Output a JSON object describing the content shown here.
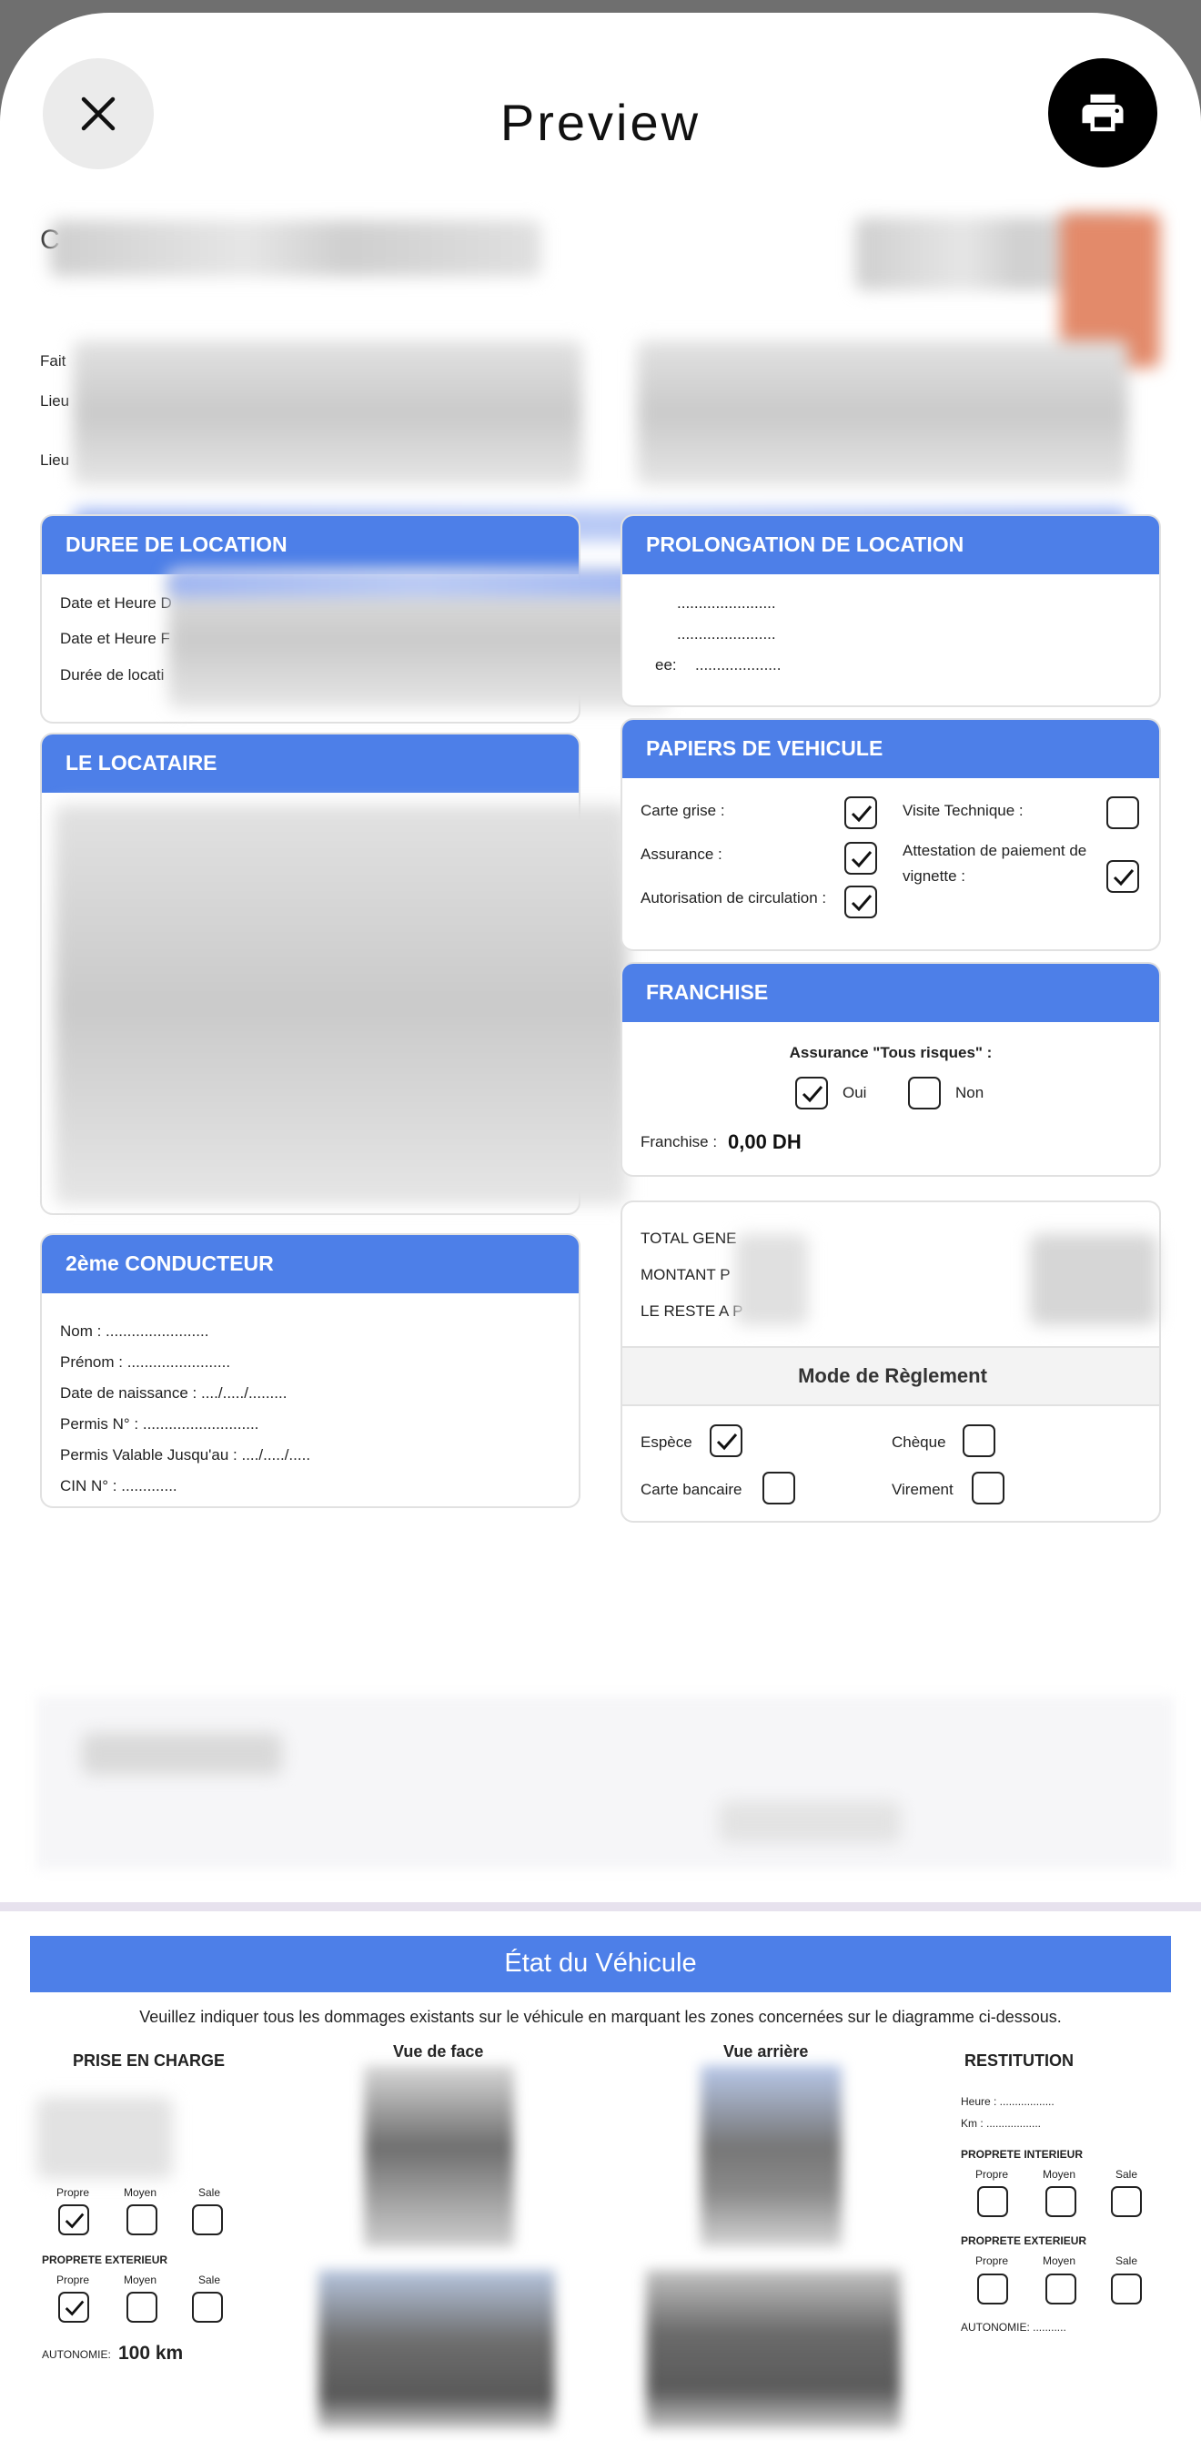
{
  "header": {
    "title": "Preview",
    "close_icon": "close-icon",
    "print_icon": "printer-icon"
  },
  "top": {
    "c_letter": "C",
    "fait": "Fait",
    "lieu1": "Lieu",
    "lieu2": "Lieu"
  },
  "duree": {
    "title": "DUREE DE LOCATION",
    "row1": "Date et Heure D",
    "row2": "Date et Heure F",
    "row3": "Durée de locati"
  },
  "prolongation": {
    "title": "PROLONGATION DE LOCATION",
    "row1": ".......................",
    "row2": ".......................",
    "row3_prefix": "ee:",
    "row3": "...................."
  },
  "locataire": {
    "title": "LE LOCATAIRE"
  },
  "papiers": {
    "title": "PAPIERS DE VEHICULE",
    "carte_grise": "Carte grise :",
    "assurance": "Assurance :",
    "autorisation": "Autorisation de circulation :",
    "visite": "Visite Technique :",
    "attestation_1": "Attestation de paiement de",
    "attestation_2": "vignette :",
    "checked": {
      "carte_grise": true,
      "assurance": true,
      "autorisation": true,
      "visite": false,
      "attestation": true
    }
  },
  "franchise": {
    "title": "FRANCHISE",
    "assurance_label": "Assurance \"Tous risques\" :",
    "oui": "Oui",
    "non": "Non",
    "oui_checked": true,
    "non_checked": false,
    "franchise_label": "Franchise :",
    "franchise_value": "0,00 DH"
  },
  "totaux": {
    "row1": "TOTAL GENE",
    "row2": "MONTANT P",
    "row3": "LE RESTE A P",
    "mode_title": "Mode de Règlement",
    "espece": "Espèce",
    "cheque": "Chèque",
    "carte": "Carte bancaire",
    "virement": "Virement",
    "espece_checked": true
  },
  "conducteur": {
    "title": "2ème CONDUCTEUR",
    "nom": "Nom :  ........................",
    "prenom": "Prénom :  ........................",
    "naissance": "Date de naissance :  ..../...../.........",
    "permis": "Permis N° :  ...........................",
    "permis_valable": "Permis Valable Jusqu'au :  ..../...../.....",
    "cin": "CIN N° :  ............."
  },
  "etat": {
    "title": "État du Véhicule",
    "instructions": "Veuillez indiquer tous les dommages existants sur le véhicule en marquant les zones concernées sur le diagramme ci-dessous.",
    "prise": "PRISE EN CHARGE",
    "vue_face": "Vue de face",
    "vue_arriere": "Vue arrière",
    "restitution": "RESTITUTION",
    "heure": "Heure : ..................",
    "km": "Km : ..................",
    "propre_int": "PROPRETE INTERIEUR",
    "propre_ext": "PROPRETE EXTERIEUR",
    "propre": "Propre",
    "moyen": "Moyen",
    "sale": "Sale",
    "autonomie_label": "AUTONOMIE:",
    "autonomie_value": "100 km",
    "autonomie_blank": "AUTONOMIE: ..........."
  }
}
